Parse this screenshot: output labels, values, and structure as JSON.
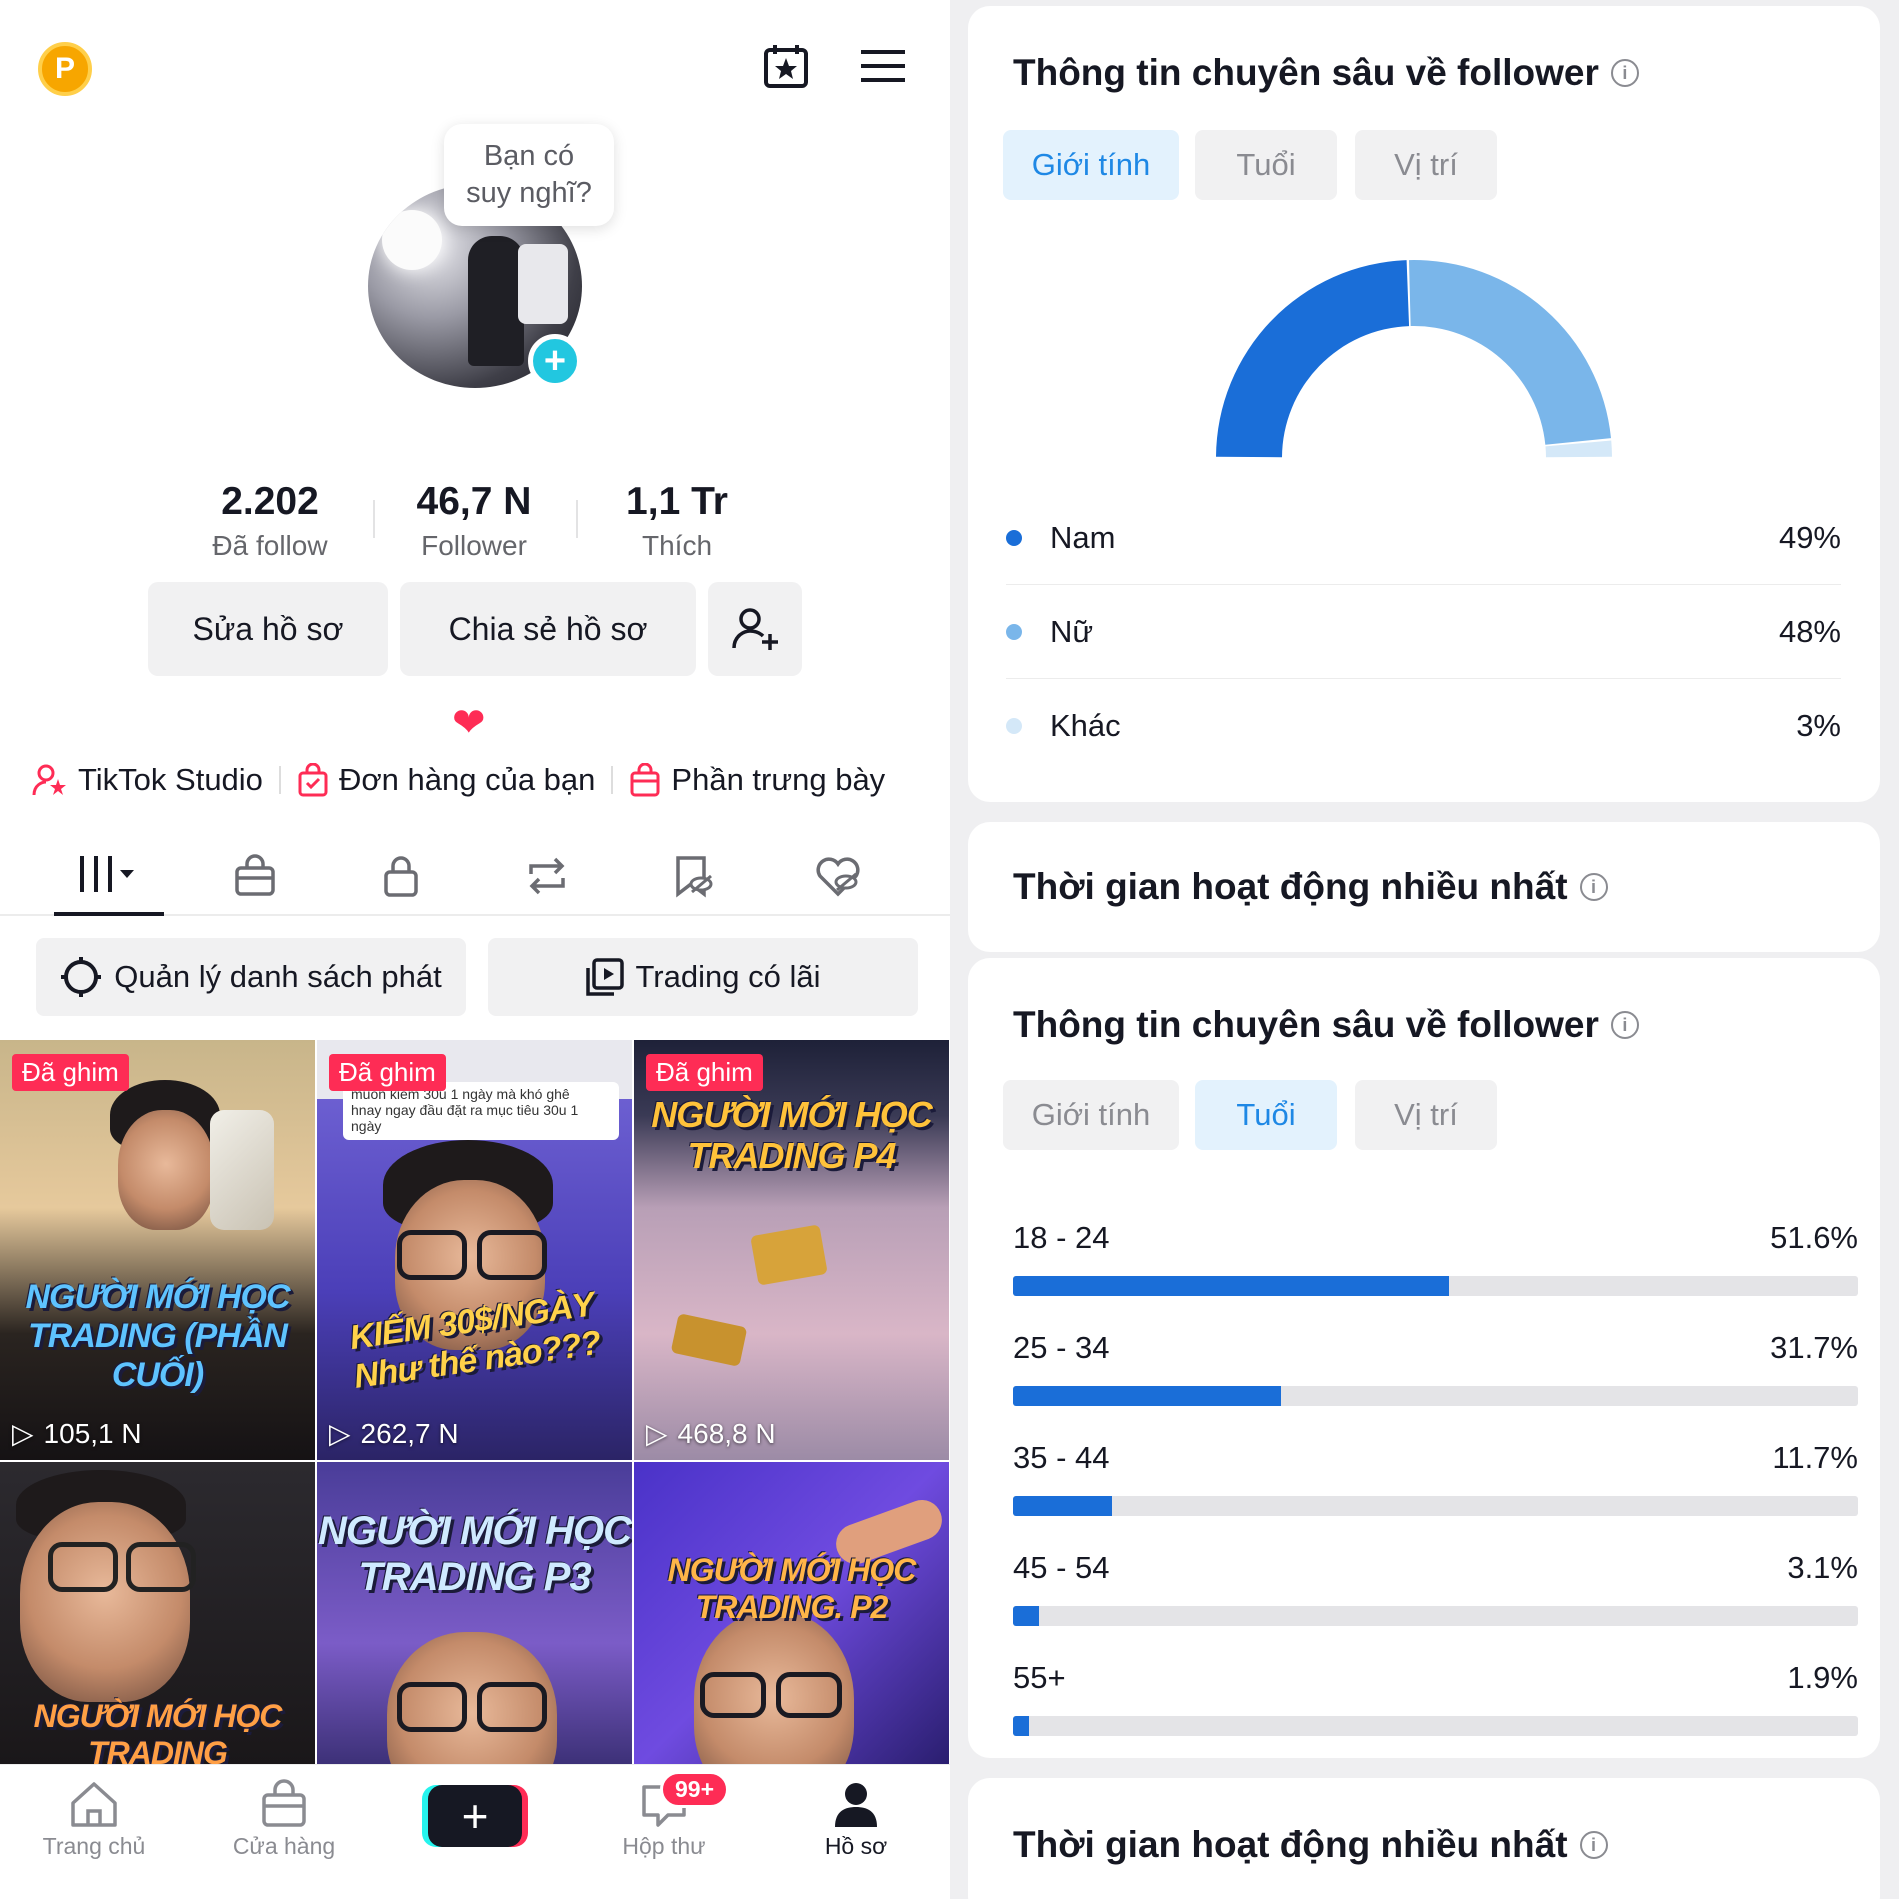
{
  "profile": {
    "bubble_text": "Bạn có suy nghĩ?",
    "stats": [
      {
        "value": "2.202",
        "label": "Đã follow"
      },
      {
        "value": "46,7 N",
        "label": "Follower"
      },
      {
        "value": "1,1 Tr",
        "label": "Thích"
      }
    ],
    "buttons": {
      "edit": "Sửa hồ sơ",
      "share": "Chia sẻ hồ sơ"
    },
    "heart": "❤",
    "links": {
      "studio": "TikTok Studio",
      "orders": "Đơn hàng của bạn",
      "showcase": "Phần trưng bày"
    },
    "chips": {
      "playlist": "Quản lý danh sách phát",
      "trading": "Trading có lãi"
    },
    "videos": [
      {
        "pinned": "Đã ghim",
        "title": "NGƯỜI MỚI HỌC TRADING (PHẦN CUỐI)",
        "views": "105,1 N"
      },
      {
        "pinned": "Đã ghim",
        "title": "KIẾM 30$/NGÀY Như thế nào???",
        "views": "262,7 N"
      },
      {
        "pinned": "Đã ghim",
        "title": "NGƯỜI MỚI HỌC TRADING P4",
        "views": "468,8 N"
      },
      {
        "pinned": "",
        "title": "NGƯỜI MỚI HỌC TRADING",
        "views": ""
      },
      {
        "pinned": "",
        "title": "NGƯỜI MỚI HỌC TRADING P3",
        "views": ""
      },
      {
        "pinned": "",
        "title": "NGƯỜI MỚI HỌC TRADING. P2",
        "views": ""
      }
    ],
    "chat_snippet": {
      "line1": "muốn kiếm 30u 1 ngày mà khó ghê",
      "line2": "hnay ngay đầu đặt ra mục tiêu 30u 1 ngày"
    }
  },
  "bottom_nav": {
    "home": "Trang chủ",
    "shop": "Cửa hàng",
    "inbox": "Hộp thư",
    "inbox_badge": "99+",
    "profile": "Hồ sơ"
  },
  "insights_gender": {
    "title": "Thông tin chuyên sâu về follower",
    "tabs": [
      "Giới tính",
      "Tuổi",
      "Vị trí"
    ],
    "active_tab": "Giới tính",
    "chart_data": {
      "type": "pie",
      "categories": [
        "Nam",
        "Nữ",
        "Khác"
      ],
      "values": [
        49,
        48,
        3
      ],
      "labels": [
        "49%",
        "48%",
        "3%"
      ],
      "colors": [
        "#1a6ed8",
        "#7ab6ea",
        "#d4e8f8"
      ]
    }
  },
  "active_time_title": "Thời gian hoạt động nhiều nhất",
  "insights_age": {
    "title": "Thông tin chuyên sâu về follower",
    "tabs": [
      "Giới tính",
      "Tuổi",
      "Vị trí"
    ],
    "active_tab": "Tuổi",
    "chart_data": {
      "type": "bar",
      "categories": [
        "18 - 24",
        "25 - 34",
        "35 - 44",
        "45 - 54",
        "55+"
      ],
      "values": [
        51.6,
        31.7,
        11.7,
        3.1,
        1.9
      ],
      "labels": [
        "51.6%",
        "31.7%",
        "11.7%",
        "3.1%",
        "1.9%"
      ],
      "ylim": [
        0,
        100
      ],
      "color": "#1a6ed8"
    }
  },
  "active_time_title_2": "Thời gian hoạt động nhiều nhất"
}
